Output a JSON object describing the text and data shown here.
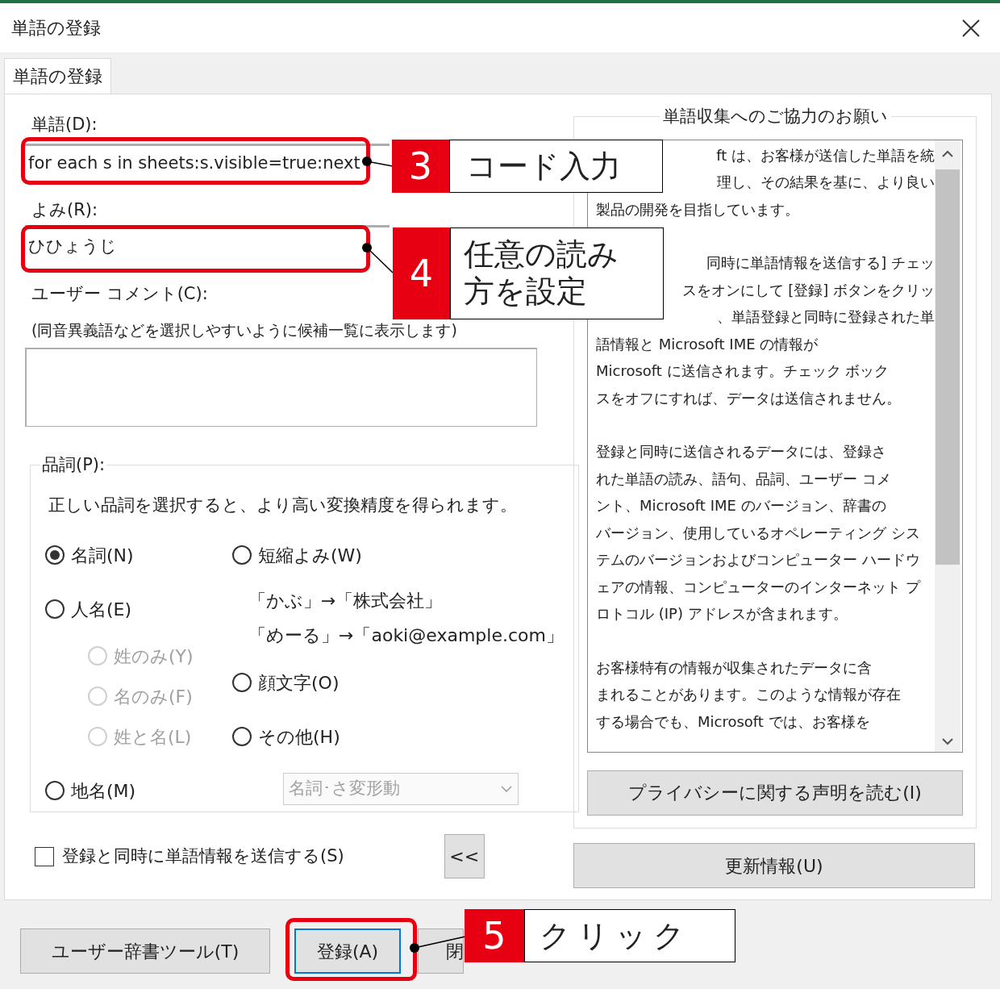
{
  "window": {
    "title": "単語の登録"
  },
  "tabs": [
    {
      "label": "単語の登録",
      "selected": true
    }
  ],
  "word": {
    "label": "単語(D):",
    "value": "for each s in sheets:s.visible=true:next"
  },
  "reading": {
    "label": "よみ(R):",
    "value": "ひひょうじ"
  },
  "comment": {
    "label": "ユーザー コメント(C):",
    "hint": "(同音異義語などを選択しやすいように候補一覧に表示します)"
  },
  "part_of_speech": {
    "label": "品詞(P):",
    "description": "正しい品詞を選択すると、より高い変換精度を得られます。",
    "column_1": [
      {
        "kind": "radio",
        "label": "名詞(N)",
        "selected": true,
        "disabled": false
      },
      {
        "kind": "radio",
        "label": "人名(E)",
        "selected": false,
        "disabled": false,
        "children": [
          {
            "kind": "radio",
            "label": "姓のみ(Y)",
            "selected": false,
            "disabled": true
          },
          {
            "kind": "radio",
            "label": "名のみ(F)",
            "selected": false,
            "disabled": true
          },
          {
            "kind": "radio",
            "label": "姓と名(L)",
            "selected": false,
            "disabled": true
          }
        ]
      },
      {
        "kind": "radio",
        "label": "地名(M)",
        "selected": false,
        "disabled": false
      }
    ],
    "column_2": [
      {
        "kind": "radio",
        "label": "短縮よみ(W)",
        "selected": false,
        "disabled": false
      },
      {
        "kind": "example",
        "label": "「かぶ」→「株式会社」"
      },
      {
        "kind": "example",
        "label": "「めーる」→「aoki@example.com」"
      },
      {
        "kind": "radio",
        "label": "顔文字(O)",
        "selected": false,
        "disabled": false
      },
      {
        "kind": "radio",
        "label": "その他(H)",
        "selected": false,
        "disabled": false
      },
      {
        "kind": "dropdown",
        "label": "名詞･さ変形動",
        "disabled": true
      }
    ]
  },
  "send_checkbox": {
    "label": "登録と同時に単語情報を送信する(S)",
    "checked": false
  },
  "collapse_button": "<<",
  "collection": {
    "title": "単語収集へのご協力のお願い",
    "paragraphs": [
      [
        {
          "kind": "partial",
          "text": "ft は、お客様が送信した単語を統"
        },
        {
          "kind": "partial",
          "text": "理し、その結果を基に、より良い"
        },
        {
          "kind": "full",
          "text": "製品の開発を目指しています。"
        }
      ],
      [
        {
          "kind": "partial",
          "text": "同時に単語情報を送信する] チェッ"
        },
        {
          "kind": "partial",
          "text": "スをオンにして [登録] ボタンをクリッ"
        },
        {
          "kind": "partial",
          "text": "、単語登録と同時に登録された単"
        },
        {
          "kind": "full",
          "text": "語情報と Microsoft IME の情報が"
        },
        {
          "kind": "full",
          "text": "Microsoft に送信されます。チェック ボック"
        },
        {
          "kind": "full",
          "text": "スをオフにすれば、データは送信されません。"
        }
      ],
      [
        {
          "kind": "full",
          "text": "登録と同時に送信されるデータには、登録さ"
        },
        {
          "kind": "full",
          "text": "れた単語の読み、語句、品詞、ユーザー コメ"
        },
        {
          "kind": "full",
          "text": "ント、Microsoft IME のバージョン、辞書の"
        },
        {
          "kind": "full",
          "text": "バージョン、使用しているオペレーティング シス"
        },
        {
          "kind": "full",
          "text": "テムのバージョンおよびコンピューター ハードウ"
        },
        {
          "kind": "full",
          "text": "ェアの情報、コンピューターのインターネット プ"
        },
        {
          "kind": "full",
          "text": "ロトコル (IP) アドレスが含まれます。"
        }
      ],
      [
        {
          "kind": "full",
          "text": "お客様特有の情報が収集されたデータに含"
        },
        {
          "kind": "full",
          "text": "まれることがあります。このような情報が存在"
        },
        {
          "kind": "full",
          "text": "する場合でも、Microsoft では、お客様を"
        }
      ]
    ],
    "privacy_button": "プライバシーに関する声明を読む(I)"
  },
  "update_button": "更新情報(U)",
  "buttons": [
    {
      "label": "ユーザー辞書ツール(T)",
      "focused": false
    },
    {
      "label": "登録(A)",
      "focused": true
    },
    {
      "label": "閉",
      "focused": false
    }
  ],
  "callouts": [
    {
      "number": "3",
      "text": "コード入力"
    },
    {
      "number": "4",
      "text": "任意の読み方を設定"
    },
    {
      "number": "5",
      "text": "クリック"
    }
  ]
}
